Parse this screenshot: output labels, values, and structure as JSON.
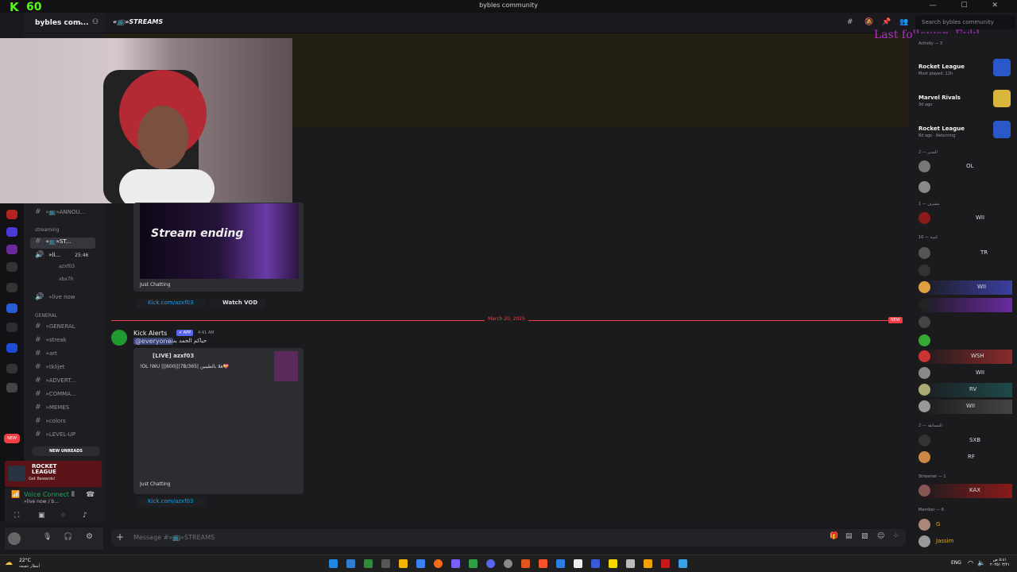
{
  "window": {
    "title": "bybles community",
    "fps": "60"
  },
  "sidebar": {
    "server_name": "bybles com...",
    "channels": [
      {
        "label": "«📺»ANNOU..."
      },
      {
        "label": "«📺»ST..."
      },
      {
        "label": "»li..."
      },
      {
        "label": "»live now"
      },
      {
        "label": "»GENERAL"
      },
      {
        "label": "»streak"
      },
      {
        "label": "»art"
      },
      {
        "label": "»tklijet"
      },
      {
        "label": "»ADVERT..."
      },
      {
        "label": "»COMMA..."
      },
      {
        "label": "»MEMES"
      },
      {
        "label": "»colors"
      },
      {
        "label": "»LEVEL-UP"
      }
    ],
    "categories": [
      "streaming",
      "GENERAL"
    ],
    "voice_users": [
      "azxf03",
      "xbx7h"
    ],
    "live_timer": "25:46",
    "new_unreads": "NEW UNREADS",
    "new_badge": "NEW"
  },
  "rl_banner": {
    "title": "ROCKET LEAGUE",
    "subtitle": "Get Rewards!"
  },
  "voice": {
    "title": "Voice Connect",
    "subtitle": "»live now / b..."
  },
  "header": {
    "channel": "«📺»STREAMS",
    "search_placeholder": "Search bybles community"
  },
  "overlay": {
    "last_follower": "Last follower: Eykl"
  },
  "messages": {
    "stream_ending_text": "Stream ending",
    "category_1": "Just Chatting",
    "link_1": "Kick.com/azxf03",
    "watch_vod": "Watch VOD",
    "date_divider": "March 20, 2025",
    "new_tag": "NEW",
    "author": "Kick Alerts",
    "app_tag": "✔ APP",
    "timestamp": "4:41 AM",
    "mention": "@everyone",
    "message_text": "حياكم الحمد بث",
    "embed_title": "[LIVE] azxf03",
    "embed_desc": "!OL !WU |||600|||7B/365| هلا بالطيبين💝",
    "category_2": "Just Chatting",
    "link_2": "Kick.com/azxf03"
  },
  "composer": {
    "placeholder": "Message #«📺»STREAMS"
  },
  "members": {
    "activity_header": "Activity — 3",
    "activities": [
      {
        "game": "Rocket League",
        "detail": "Most played: 12h"
      },
      {
        "game": "Marvel Rivals",
        "detail": "3d ago"
      },
      {
        "game": "Rocket League",
        "detail": "8d ago · Returning"
      }
    ],
    "groups": [
      "المدير — 2",
      "مشرف — 1",
      "كتيبة — 10",
      "المسابقة — 2",
      "Streamer — 1",
      "Member — 6"
    ],
    "names": [
      "OL",
      "WII",
      "TR",
      "WII",
      "WSH",
      "WII",
      "RV",
      "WII",
      "SXB",
      "RF",
      "KAX",
      "G",
      "Jassim"
    ]
  },
  "taskbar": {
    "temp": "22°C",
    "condition": "أمطار خفيفة",
    "lang": "ENG",
    "time": "٥:٤١ ص",
    "date": "٢٠٢٥/٠٣/٢١"
  },
  "colors": {
    "kick_green": "#53fc18",
    "accent_red": "#f23f43",
    "link_blue": "#00a8fc"
  }
}
